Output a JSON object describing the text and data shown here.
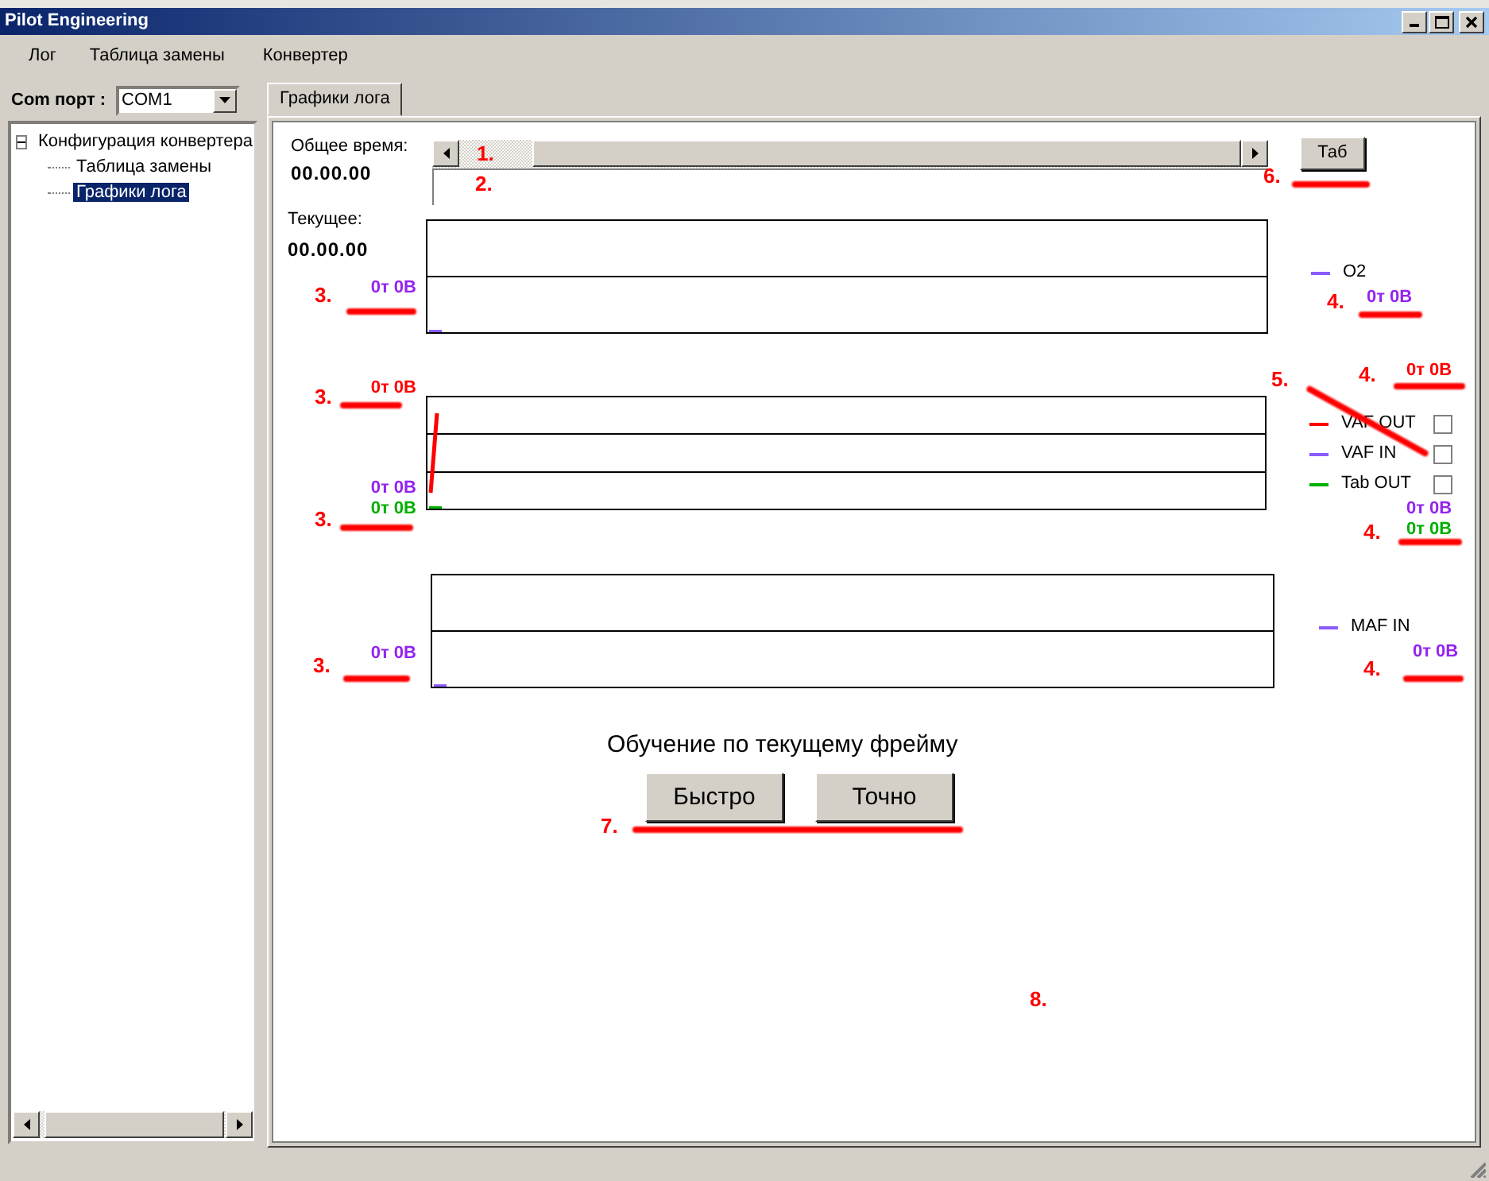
{
  "window": {
    "title": "Pilot Engineering"
  },
  "menu": [
    "Лог",
    "Таблица замены",
    "Конвертер"
  ],
  "com_port": {
    "label": "Com порт :",
    "value": "COM1"
  },
  "tree": [
    {
      "label": "Конфигурация конвертера",
      "expanded": true,
      "selected": false,
      "children": [
        {
          "label": "Таблица замены",
          "selected": false
        },
        {
          "label": "Графики лога",
          "selected": true
        }
      ]
    }
  ],
  "tabs": [
    {
      "label": "Графики лога",
      "selected": true
    }
  ],
  "total_time": {
    "label": "Общее время:",
    "value": "00.00.00"
  },
  "current_time": {
    "label": "Текущее:",
    "value": "00.00.00"
  },
  "tab_button": "Таб",
  "charts": [
    {
      "left_bottom": [
        {
          "text": "0т 0В",
          "color": "#9424f0"
        }
      ],
      "legend": [
        {
          "name": "O2",
          "color": "#8a5cff",
          "kind": "line"
        }
      ],
      "right_bottom": [
        {
          "text": "0т 0В",
          "color": "#9424f0"
        }
      ],
      "trace": false
    },
    {
      "left_top": [
        {
          "text": "0т 0В",
          "color": "#ff0000"
        }
      ],
      "left_bottom": [
        {
          "text": "0т 0В",
          "color": "#9424f0"
        },
        {
          "text": "0т 0В",
          "color": "#00b000"
        }
      ],
      "right_top": [
        {
          "text": "0т 0В",
          "color": "#ff0000"
        }
      ],
      "legend": [
        {
          "name": "VAF OUT",
          "color": "#ff0000",
          "kind": "checkbox",
          "checked": false
        },
        {
          "name": "VAF IN",
          "color": "#8a5cff",
          "kind": "checkbox",
          "checked": false
        },
        {
          "name": "Tab OUT",
          "color": "#00b000",
          "kind": "checkbox",
          "checked": false
        }
      ],
      "right_bottom": [
        {
          "text": "0т 0В",
          "color": "#9424f0"
        },
        {
          "text": "0т 0В",
          "color": "#00b000"
        }
      ],
      "trace": true
    },
    {
      "left_bottom": [
        {
          "text": "0т 0В",
          "color": "#9424f0"
        }
      ],
      "legend": [
        {
          "name": "MAF IN",
          "color": "#8a5cff",
          "kind": "line"
        }
      ],
      "right_bottom": [
        {
          "text": "0т 0В",
          "color": "#9424f0"
        }
      ],
      "trace": false
    }
  ],
  "training": {
    "title": "Обучение по текущему фрейму",
    "buttons": [
      "Быстро",
      "Точно"
    ]
  },
  "annotations": [
    "1.",
    "2.",
    "3.",
    "3.",
    "3.",
    "3.",
    "4.",
    "4.",
    "4.",
    "4.",
    "5.",
    "6.",
    "7.",
    "8."
  ]
}
